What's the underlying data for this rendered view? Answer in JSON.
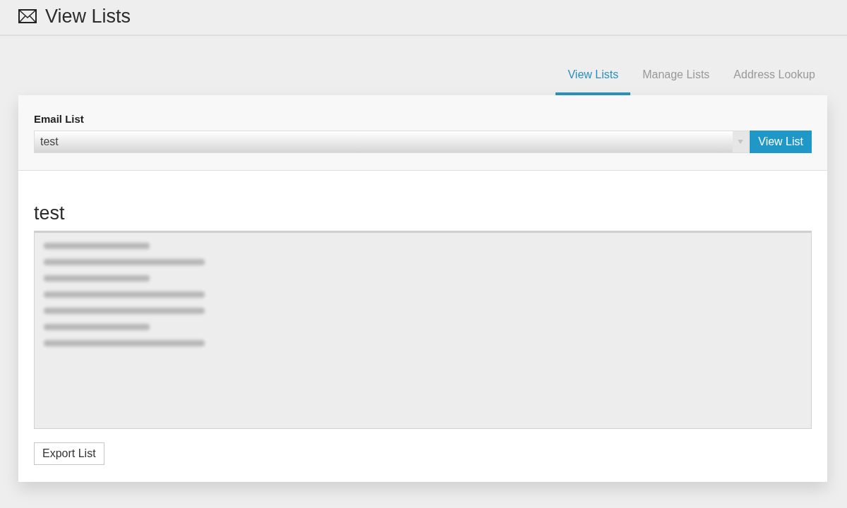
{
  "header": {
    "title": "View Lists"
  },
  "tabs": [
    {
      "label": "View Lists",
      "selected": true
    },
    {
      "label": "Manage Lists",
      "selected": false
    },
    {
      "label": "Address Lookup",
      "selected": false
    }
  ],
  "list_picker": {
    "label": "Email List",
    "value": "test",
    "button": "View List"
  },
  "list_view": {
    "title": "test",
    "content_blurred": true,
    "button": "Export List"
  }
}
